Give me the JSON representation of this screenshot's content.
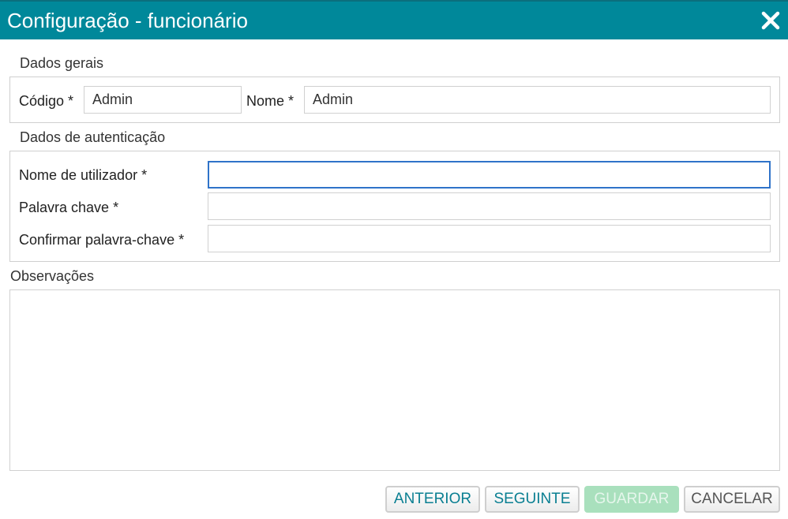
{
  "dialog": {
    "title": "Configuração - funcionário",
    "close_icon": "close-icon"
  },
  "general": {
    "section_label": "Dados gerais",
    "code_label": "Código *",
    "code_value": "Admin",
    "name_label": "Nome *",
    "name_value": "Admin"
  },
  "auth": {
    "section_label": "Dados de autenticação",
    "username_label": "Nome de utilizador *",
    "username_value": "",
    "password_label": "Palavra chave *",
    "password_value": "",
    "confirm_label": "Confirmar palavra-chave *",
    "confirm_value": ""
  },
  "notes": {
    "label": "Observações",
    "value": ""
  },
  "buttons": {
    "previous": "ANTERIOR",
    "next": "SEGUINTE",
    "save": "GUARDAR",
    "cancel": "CANCELAR"
  },
  "colors": {
    "titlebar": "#00889a",
    "accent_text": "#0a7f92",
    "disabled_button": "#a9e0bd",
    "focus_border": "#2f73c9"
  }
}
